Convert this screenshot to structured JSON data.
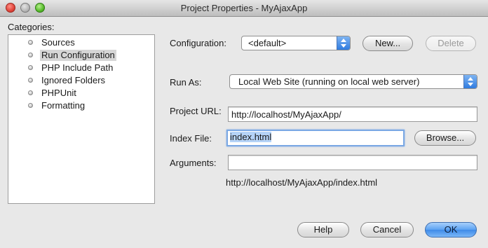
{
  "window": {
    "title": "Project Properties - MyAjaxApp"
  },
  "categories": {
    "label": "Categories:",
    "items": [
      {
        "label": "Sources"
      },
      {
        "label": "Run Configuration",
        "selected": true
      },
      {
        "label": "PHP Include Path"
      },
      {
        "label": "Ignored Folders"
      },
      {
        "label": "PHPUnit"
      },
      {
        "label": "Formatting"
      }
    ]
  },
  "configuration": {
    "label": "Configuration:",
    "value": "<default>",
    "new_label": "New...",
    "delete_label": "Delete"
  },
  "run_as": {
    "label": "Run As:",
    "value": "Local Web Site (running on local web server)"
  },
  "project_url": {
    "label": "Project URL:",
    "value": "http://localhost/MyAjaxApp/"
  },
  "index_file": {
    "label": "Index File:",
    "value": "index.html",
    "browse_label": "Browse..."
  },
  "arguments": {
    "label": "Arguments:",
    "value": ""
  },
  "resolved_url": "http://localhost/MyAjaxApp/index.html",
  "footer": {
    "help_label": "Help",
    "cancel_label": "Cancel",
    "ok_label": "OK"
  },
  "colors": {
    "accent": "#3e8ae8",
    "focus_ring": "#7aa8e4",
    "selection": "#b5d3f7"
  }
}
